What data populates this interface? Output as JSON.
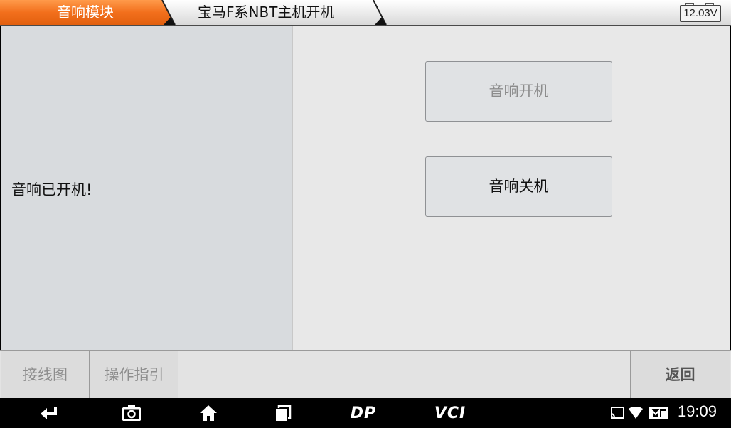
{
  "header": {
    "tabs": [
      {
        "label": "音响模块"
      },
      {
        "label": "宝马F系NBT主机开机"
      }
    ],
    "battery_voltage": "12.03V",
    "active_tab_color": "#f26f1c"
  },
  "main": {
    "status_message": "音响已开机!",
    "buttons": {
      "power_on": "音响开机",
      "power_off": "音响关机"
    }
  },
  "footer": {
    "wiring_diagram": "接线图",
    "operation_guide": "操作指引",
    "back": "返回"
  },
  "system_bar": {
    "icons": [
      "back-icon",
      "camera-icon",
      "home-icon",
      "recent-apps-icon",
      "dp-icon",
      "vci-icon",
      "cast-icon",
      "wifi-icon",
      "signal-icon"
    ],
    "dp_label": "DP",
    "vci_label": "VCI",
    "time": "19:09"
  }
}
